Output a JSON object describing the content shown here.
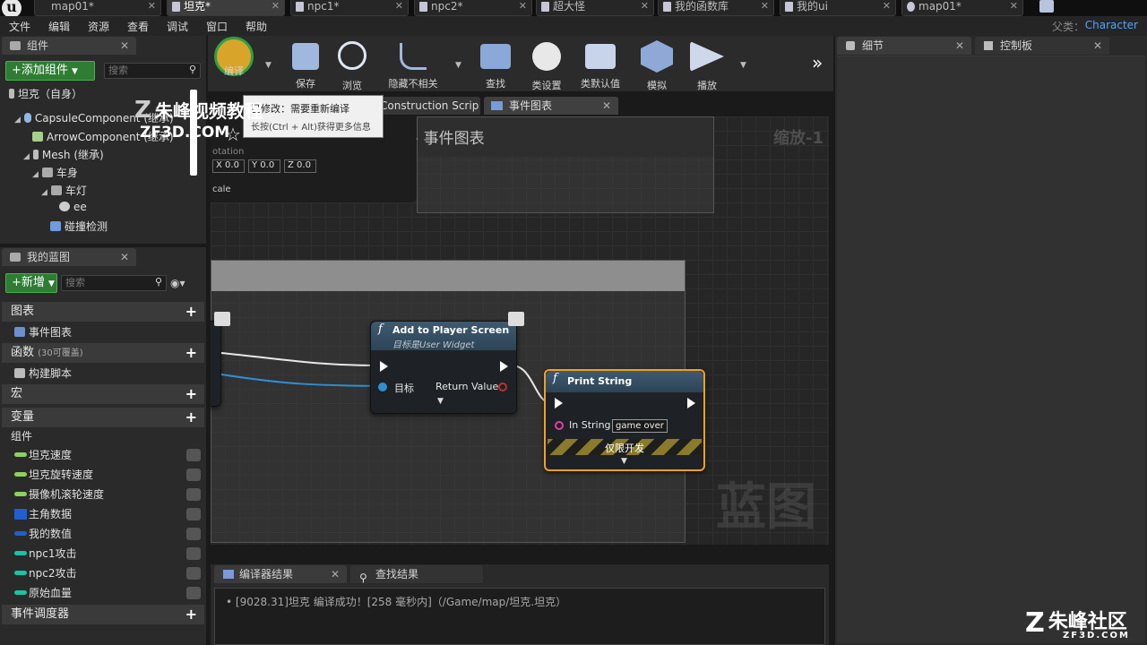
{
  "window_tabs": [
    {
      "label": "map01*",
      "active": false
    },
    {
      "label": "坦克*",
      "active": true
    },
    {
      "label": "npc1*",
      "active": false
    },
    {
      "label": "npc2*",
      "active": false
    },
    {
      "label": "超大怪",
      "active": false
    },
    {
      "label": "我的函数库",
      "active": false
    },
    {
      "label": "我的ui",
      "active": false
    },
    {
      "label": "map01*",
      "active": false
    }
  ],
  "app_logo": "u",
  "menu": [
    "文件",
    "编辑",
    "资源",
    "查看",
    "调试",
    "窗口",
    "帮助"
  ],
  "parent_class": {
    "label": "父类：",
    "value": "Character"
  },
  "components_panel": {
    "tab": "组件",
    "add_button": "+添加组件",
    "search_placeholder": "搜索",
    "self_item": "坦克（自身）",
    "tree": [
      {
        "label": "CapsuleComponent (继承)",
        "depth": 1
      },
      {
        "label": "ArrowComponent (继承)",
        "depth": 2
      },
      {
        "label": "Mesh (继承)",
        "depth": 2
      },
      {
        "label": "车身",
        "depth": 3
      },
      {
        "label": "车灯",
        "depth": 4
      },
      {
        "label": "ee",
        "depth": 5
      },
      {
        "label": "碰撞检测",
        "depth": 4
      }
    ]
  },
  "my_blueprint": {
    "tab": "我的蓝图",
    "add_button": "+新增",
    "search_placeholder": "搜索",
    "graphs_header": "图表",
    "event_graph_item": "事件图表",
    "functions_header": "函数",
    "functions_note": "(30可覆盖)",
    "construct_item": "构建脚本",
    "macros_header": "宏",
    "variables_header": "变量",
    "components_group": "组件",
    "variables": [
      {
        "label": "坦克速度",
        "color": "#8bd35a"
      },
      {
        "label": "坦克旋转速度",
        "color": "#8bd35a"
      },
      {
        "label": "摄像机滚轮速度",
        "color": "#8bd35a"
      },
      {
        "label": "主角数据",
        "color": "#1f5fd1",
        "grid": true
      },
      {
        "label": "我的数值",
        "color": "#1f5fd1"
      },
      {
        "label": "npc1攻击",
        "color": "#19c3a6"
      },
      {
        "label": "npc2攻击",
        "color": "#19c3a6"
      },
      {
        "label": "原始血量",
        "color": "#19c3a6"
      }
    ],
    "dispatchers_header": "事件调度器"
  },
  "toolbar": [
    {
      "label": "编译",
      "name": "compile"
    },
    {
      "label": "保存",
      "name": "save"
    },
    {
      "label": "浏览",
      "name": "browse"
    },
    {
      "label": "隐藏不相关",
      "name": "hide-unrelated"
    },
    {
      "label": "查找",
      "name": "find"
    },
    {
      "label": "类设置",
      "name": "class-settings"
    },
    {
      "label": "类默认值",
      "name": "class-defaults"
    },
    {
      "label": "模拟",
      "name": "simulate"
    },
    {
      "label": "播放",
      "name": "play"
    }
  ],
  "tooltip": {
    "line1": "已修改：需要重新编译",
    "line2": "长按(Ctrl + Alt)获得更多信息"
  },
  "doc_tabs": [
    {
      "label": "Construction Scrip"
    },
    {
      "label": "事件图表"
    }
  ],
  "graph": {
    "breadcrumb": "坦克 › 事件图表",
    "zoom": "缩放-1",
    "watermark": "蓝图",
    "rotation_label": "otation",
    "rotation": {
      "x": "0.0",
      "y": "0.0",
      "z": "0.0"
    },
    "scale_label": "cale",
    "add_node": {
      "title": "Add to Player Screen",
      "subtitle": "目标是User Widget",
      "pin_target": "目标",
      "pin_return": "Return Value"
    },
    "print_node": {
      "title": "Print String",
      "pin_in": "In String",
      "value": "game over",
      "dev_only": "仅限开发"
    }
  },
  "results": {
    "tabs": [
      "编译器结果",
      "查找结果"
    ],
    "log": "[9028.31]坦克 编译成功！[258 毫秒内]（/Game/map/坦克.坦克）"
  },
  "details": {
    "tab1": "细节",
    "tab2": "控制板"
  },
  "watermarks": {
    "left_brand": "朱峰视频教程",
    "left_url": "ZF3D.COM",
    "right_brand": "朱峰社区",
    "right_url": "ZF3D.COM"
  }
}
